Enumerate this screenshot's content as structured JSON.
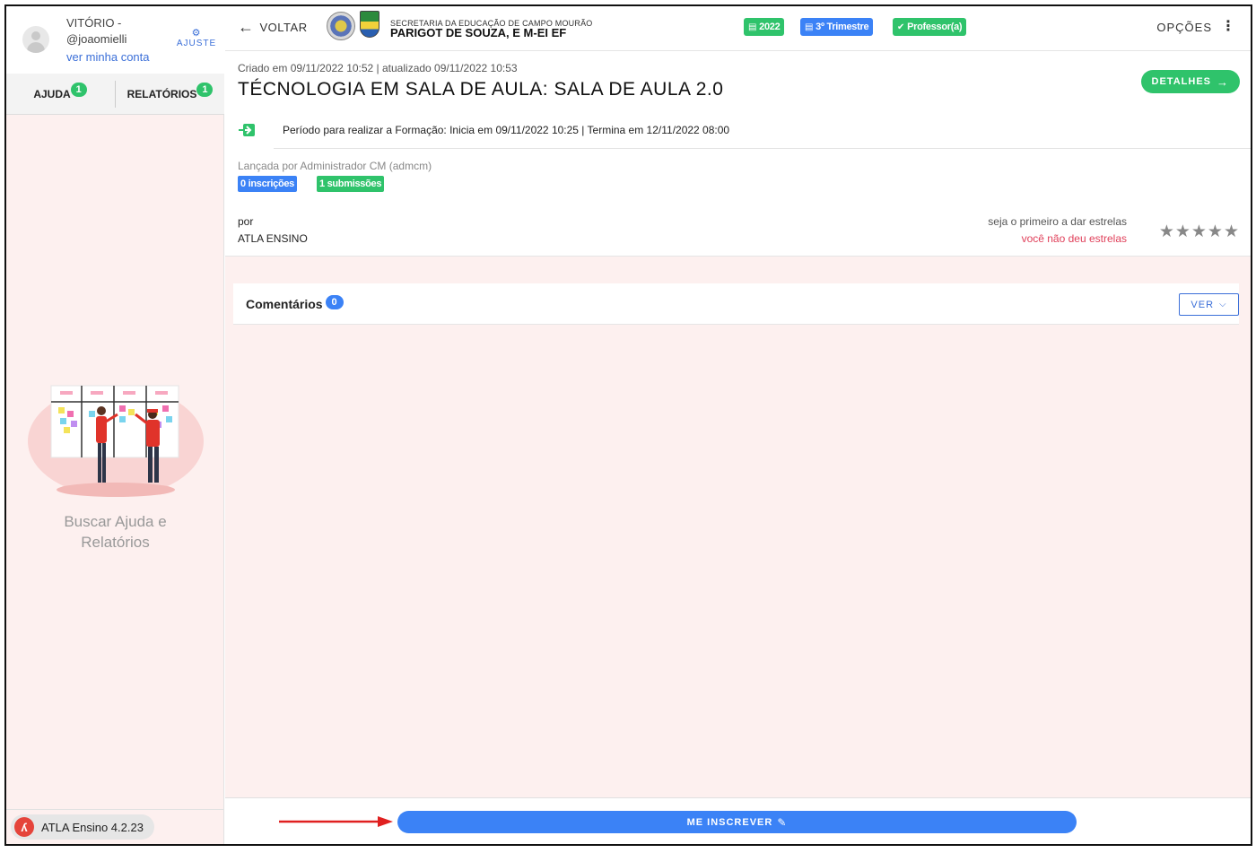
{
  "user": {
    "name": "VITÓRIO -",
    "handle": "@joaomielli",
    "account_link": "ver minha conta",
    "settings_label": "AJUSTE"
  },
  "sidebar": {
    "tabs": [
      {
        "label": "AJUDA",
        "count": "1"
      },
      {
        "label": "RELATÓRIOS",
        "count": "1"
      }
    ],
    "help_text_line1": "Buscar Ajuda e",
    "help_text_line2": "Relatórios",
    "version": "ATLA Ensino 4.2.23"
  },
  "topbar": {
    "back_label": "VOLTAR",
    "school_sub": "SECRETARIA DA EDUCAÇÃO DE CAMPO MOURÃO",
    "school_name": "PARIGOT DE SOUZA, E M-EI EF",
    "chips": [
      {
        "label": "2022",
        "color": "#2fc36b",
        "icon": "calendar-icon"
      },
      {
        "label": "3º Trimestre",
        "color": "#3b82f6",
        "icon": "calendar-icon"
      },
      {
        "label": "Professor(a)",
        "color": "#2fc36b",
        "icon": "check-circle-icon"
      }
    ],
    "options_label": "OPÇÕES"
  },
  "course": {
    "created": "Criado em 09/11/2022 10:52 | atualizado 09/11/2022 10:53",
    "title": "TÉCNOLOGIA EM SALA DE AULA: SALA DE AULA 2.0",
    "details_label": "DETALHES",
    "period": "Período para realizar a Formação: Inicia em 09/11/2022 10:25 | Termina em 12/11/2022 08:00",
    "launched_by": "Lançada por Administrador CM (admcm)",
    "enrollments_tag": "0 inscrições",
    "submissions_tag": "1 submissões",
    "by_label": "por",
    "author": "ATLA ENSINO",
    "stars_hint": "seja o primeiro a dar estrelas",
    "stars_none": "você não deu estrelas",
    "stars": "★★★★★"
  },
  "comments": {
    "label": "Comentários",
    "count": "0",
    "view_label": "VER"
  },
  "footer": {
    "enroll_label": "ME INSCREVER"
  },
  "colors": {
    "accent_green": "#2fc36b",
    "accent_blue": "#3b82f6",
    "background_pink": "#fdf0ef",
    "alert_red": "#e0405a"
  }
}
